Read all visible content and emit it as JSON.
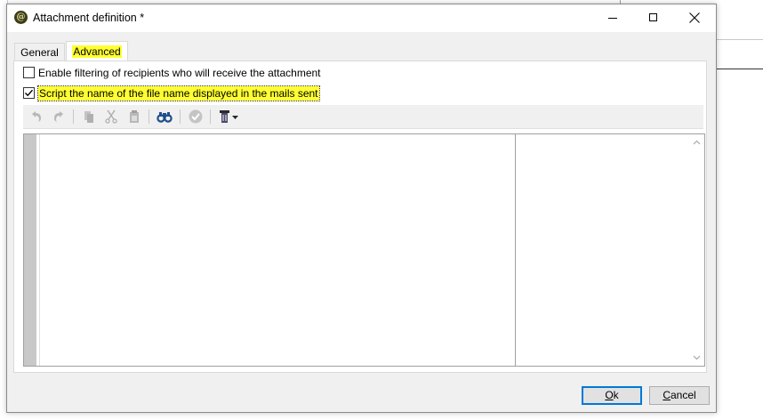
{
  "window": {
    "title": "Attachment definition *",
    "app_icon": "adobe-campaign-icon",
    "controls": [
      "minimize",
      "maximize",
      "close"
    ]
  },
  "tabs": [
    {
      "label": "General",
      "active": false
    },
    {
      "label": "Advanced",
      "active": true,
      "highlighted": true
    }
  ],
  "options": {
    "filter_recipients": {
      "label": "Enable filtering of recipients who will receive the attachment",
      "checked": false
    },
    "script_filename": {
      "label": "Script the name of the file name displayed in the mails sent",
      "checked": true,
      "highlighted": true
    }
  },
  "toolbar": {
    "icons": [
      "undo-icon",
      "redo-icon",
      "copy-icon",
      "cut-icon",
      "paste-icon",
      "find-icon",
      "check-icon",
      "insert-field-icon"
    ]
  },
  "editor": {
    "content": ""
  },
  "buttons": {
    "ok": {
      "prefix": "",
      "accel": "O",
      "suffix": "k"
    },
    "cancel": {
      "prefix": "",
      "accel": "C",
      "suffix": "ancel"
    }
  },
  "colors": {
    "highlight": "#ffff33",
    "focus_border": "#0078d7",
    "toolbar_bg": "#f0f0f0"
  }
}
